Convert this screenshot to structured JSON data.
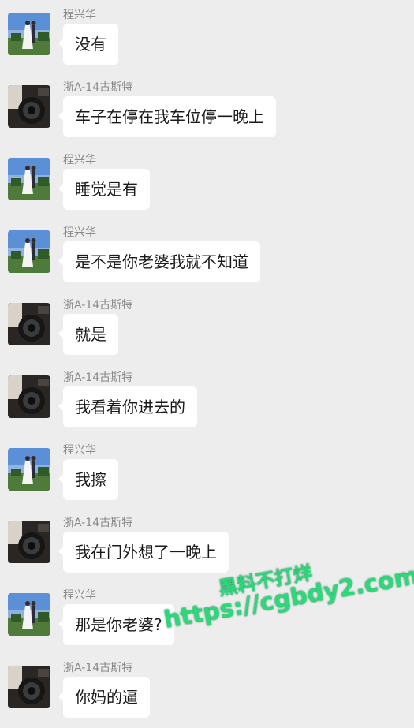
{
  "messages": [
    {
      "sender": "程兴华",
      "text": "没有",
      "avatar": "couple-avatar"
    },
    {
      "sender": "浙A-14古斯特",
      "text": "车子在停在我车位停一晚上",
      "avatar": "dark-avatar"
    },
    {
      "sender": "程兴华",
      "text": "睡觉是有",
      "avatar": "couple-avatar"
    },
    {
      "sender": "程兴华",
      "text": "是不是你老婆我就不知道",
      "avatar": "couple-avatar"
    },
    {
      "sender": "浙A-14古斯特",
      "text": "就是",
      "avatar": "dark-avatar"
    },
    {
      "sender": "浙A-14古斯特",
      "text": "我看着你进去的",
      "avatar": "dark-avatar"
    },
    {
      "sender": "程兴华",
      "text": "我擦",
      "avatar": "couple-avatar"
    },
    {
      "sender": "浙A-14古斯特",
      "text": "我在门外想了一晚上",
      "avatar": "dark-avatar"
    },
    {
      "sender": "程兴华",
      "text": "那是你老婆?",
      "avatar": "couple-avatar"
    },
    {
      "sender": "浙A-14古斯特",
      "text": "你妈的逼",
      "avatar": "dark-avatar"
    }
  ],
  "watermark": {
    "line1": "黑料不打烊",
    "line2": "https://cgbdy2.com"
  }
}
